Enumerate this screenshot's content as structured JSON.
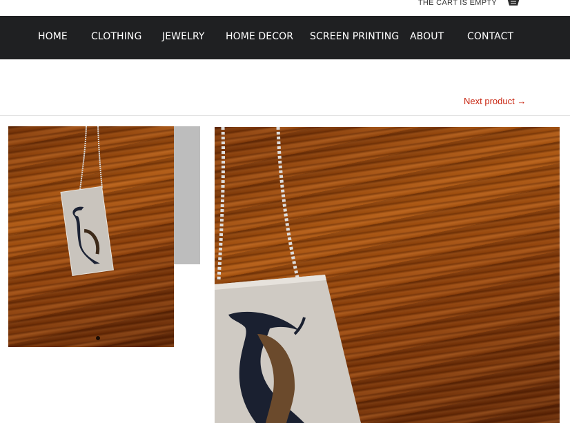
{
  "header": {
    "cart_status": "THE CART IS EMPTY",
    "cart_icon": "basket-icon"
  },
  "nav": {
    "items": [
      {
        "label": "HOME"
      },
      {
        "label": "CLOTHING"
      },
      {
        "label": "JEWELRY"
      },
      {
        "label": "HOME DECOR"
      },
      {
        "label": "SCREEN PRINTING"
      },
      {
        "label": "ABOUT"
      },
      {
        "label": "CONTACT"
      }
    ]
  },
  "product": {
    "next_link": "Next product →"
  },
  "colors": {
    "nav_bg": "#1f2022",
    "accent": "#c8240f"
  }
}
